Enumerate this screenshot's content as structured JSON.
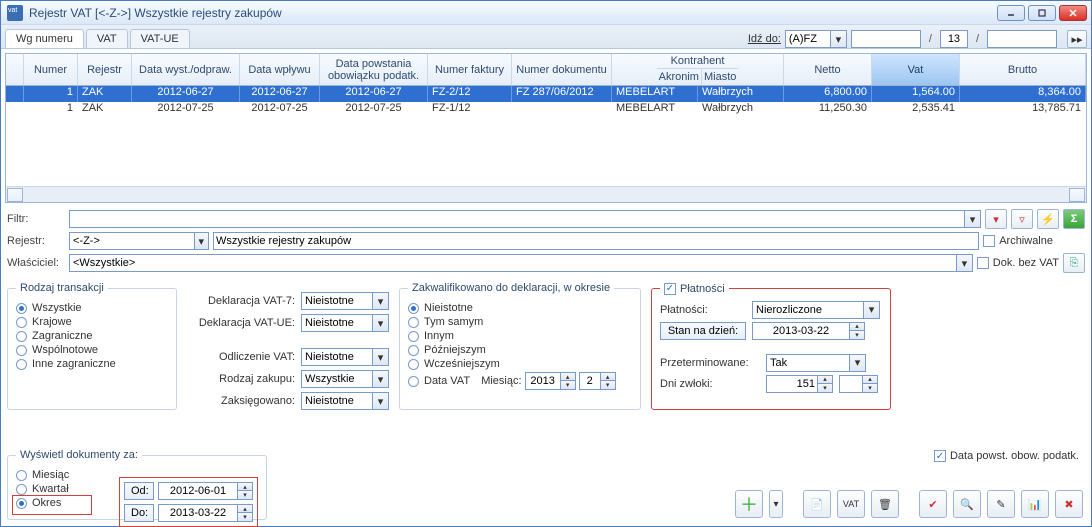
{
  "title": "Rejestr VAT   [<-Z->]   Wszystkie rejestry zakupów",
  "tabs": [
    "Wg numeru",
    "VAT",
    "VAT-UE"
  ],
  "goto": {
    "label": "Idź do:",
    "value": "(A)FZ",
    "page_cur": "13"
  },
  "grid": {
    "headers": {
      "numer": "Numer",
      "rejestr": "Rejestr",
      "dwyst": "Data wyst./odpraw.",
      "dwpl": "Data wpływu",
      "dpow": "Data powstania obowiązku podatk.",
      "nfakt": "Numer faktury",
      "ndok": "Numer dokumentu",
      "kontr": "Kontrahent",
      "akronim": "Akronim",
      "miasto": "Miasto",
      "netto": "Netto",
      "vat": "Vat",
      "brutto": "Brutto"
    },
    "rows": [
      {
        "numer": "1",
        "rejestr": "ZAK",
        "dwyst": "2012-06-27",
        "dwpl": "2012-06-27",
        "dpow": "2012-06-27",
        "nfakt": "FZ-2/12",
        "ndok": "FZ 287/06/2012",
        "akronim": "MEBELART",
        "miasto": "Wałbrzych",
        "netto": "6,800.00",
        "vat": "1,564.00",
        "brutto": "8,364.00",
        "sel": true
      },
      {
        "numer": "1",
        "rejestr": "ZAK",
        "dwyst": "2012-07-25",
        "dwpl": "2012-07-25",
        "dpow": "2012-07-25",
        "nfakt": "FZ-1/12",
        "ndok": "",
        "akronim": "MEBELART",
        "miasto": "Wałbrzych",
        "netto": "11,250.30",
        "vat": "2,535.41",
        "brutto": "13,785.71",
        "sel": false
      }
    ]
  },
  "filters": {
    "filtr_lbl": "Filtr:",
    "filtr": "",
    "rejestr_lbl": "Rejestr:",
    "rejestr_val": "<-Z->",
    "rejestr_desc": "Wszystkie rejestry zakupów",
    "wlasciciel_lbl": "Właściciel:",
    "wlasciciel": "<Wszystkie>",
    "archiwalne": "Archiwalne",
    "dokbezvat": "Dok. bez VAT"
  },
  "rodzaj": {
    "legend": "Rodzaj transakcji",
    "opts": [
      "Wszystkie",
      "Krajowe",
      "Zagraniczne",
      "Wspólnotowe",
      "Inne zagraniczne"
    ],
    "sel": 0
  },
  "dekl": {
    "vat7_lbl": "Deklaracja VAT-7:",
    "vat7": "Nieistotne",
    "vatue_lbl": "Deklaracja VAT-UE:",
    "vatue": "Nieistotne",
    "odl_lbl": "Odliczenie VAT:",
    "odl": "Nieistotne",
    "rodz_lbl": "Rodzaj zakupu:",
    "rodz": "Wszystkie",
    "zaks_lbl": "Zaksięgowano:",
    "zaks": "Nieistotne"
  },
  "zakw": {
    "legend": "Zakwalifikowano do deklaracji, w okresie",
    "opts": [
      "Nieistotne",
      "Tym samym",
      "Innym",
      "Późniejszym",
      "Wcześniejszym",
      "Data VAT"
    ],
    "sel": 0,
    "miesiac_lbl": "Miesiąc:",
    "rok": "2013",
    "nr": "2"
  },
  "plat": {
    "chk": "Płatności",
    "plat_lbl": "Płatności:",
    "plat_val": "Nierozliczone",
    "stan_btn": "Stan na dzień:",
    "stan_val": "2013-03-22",
    "przet_lbl": "Przeterminowane:",
    "przet_val": "Tak",
    "dni_lbl": "Dni zwłoki:",
    "dni_val": "151"
  },
  "data_powst": "Data powst. obow. podatk.",
  "wysw": {
    "legend": "Wyświetl dokumenty za:",
    "opts": [
      "Miesiąc",
      "Kwartał",
      "Okres"
    ],
    "sel": 2,
    "od_btn": "Od:",
    "od": "2012-06-01",
    "do_btn": "Do:",
    "do": "2013-03-22"
  }
}
